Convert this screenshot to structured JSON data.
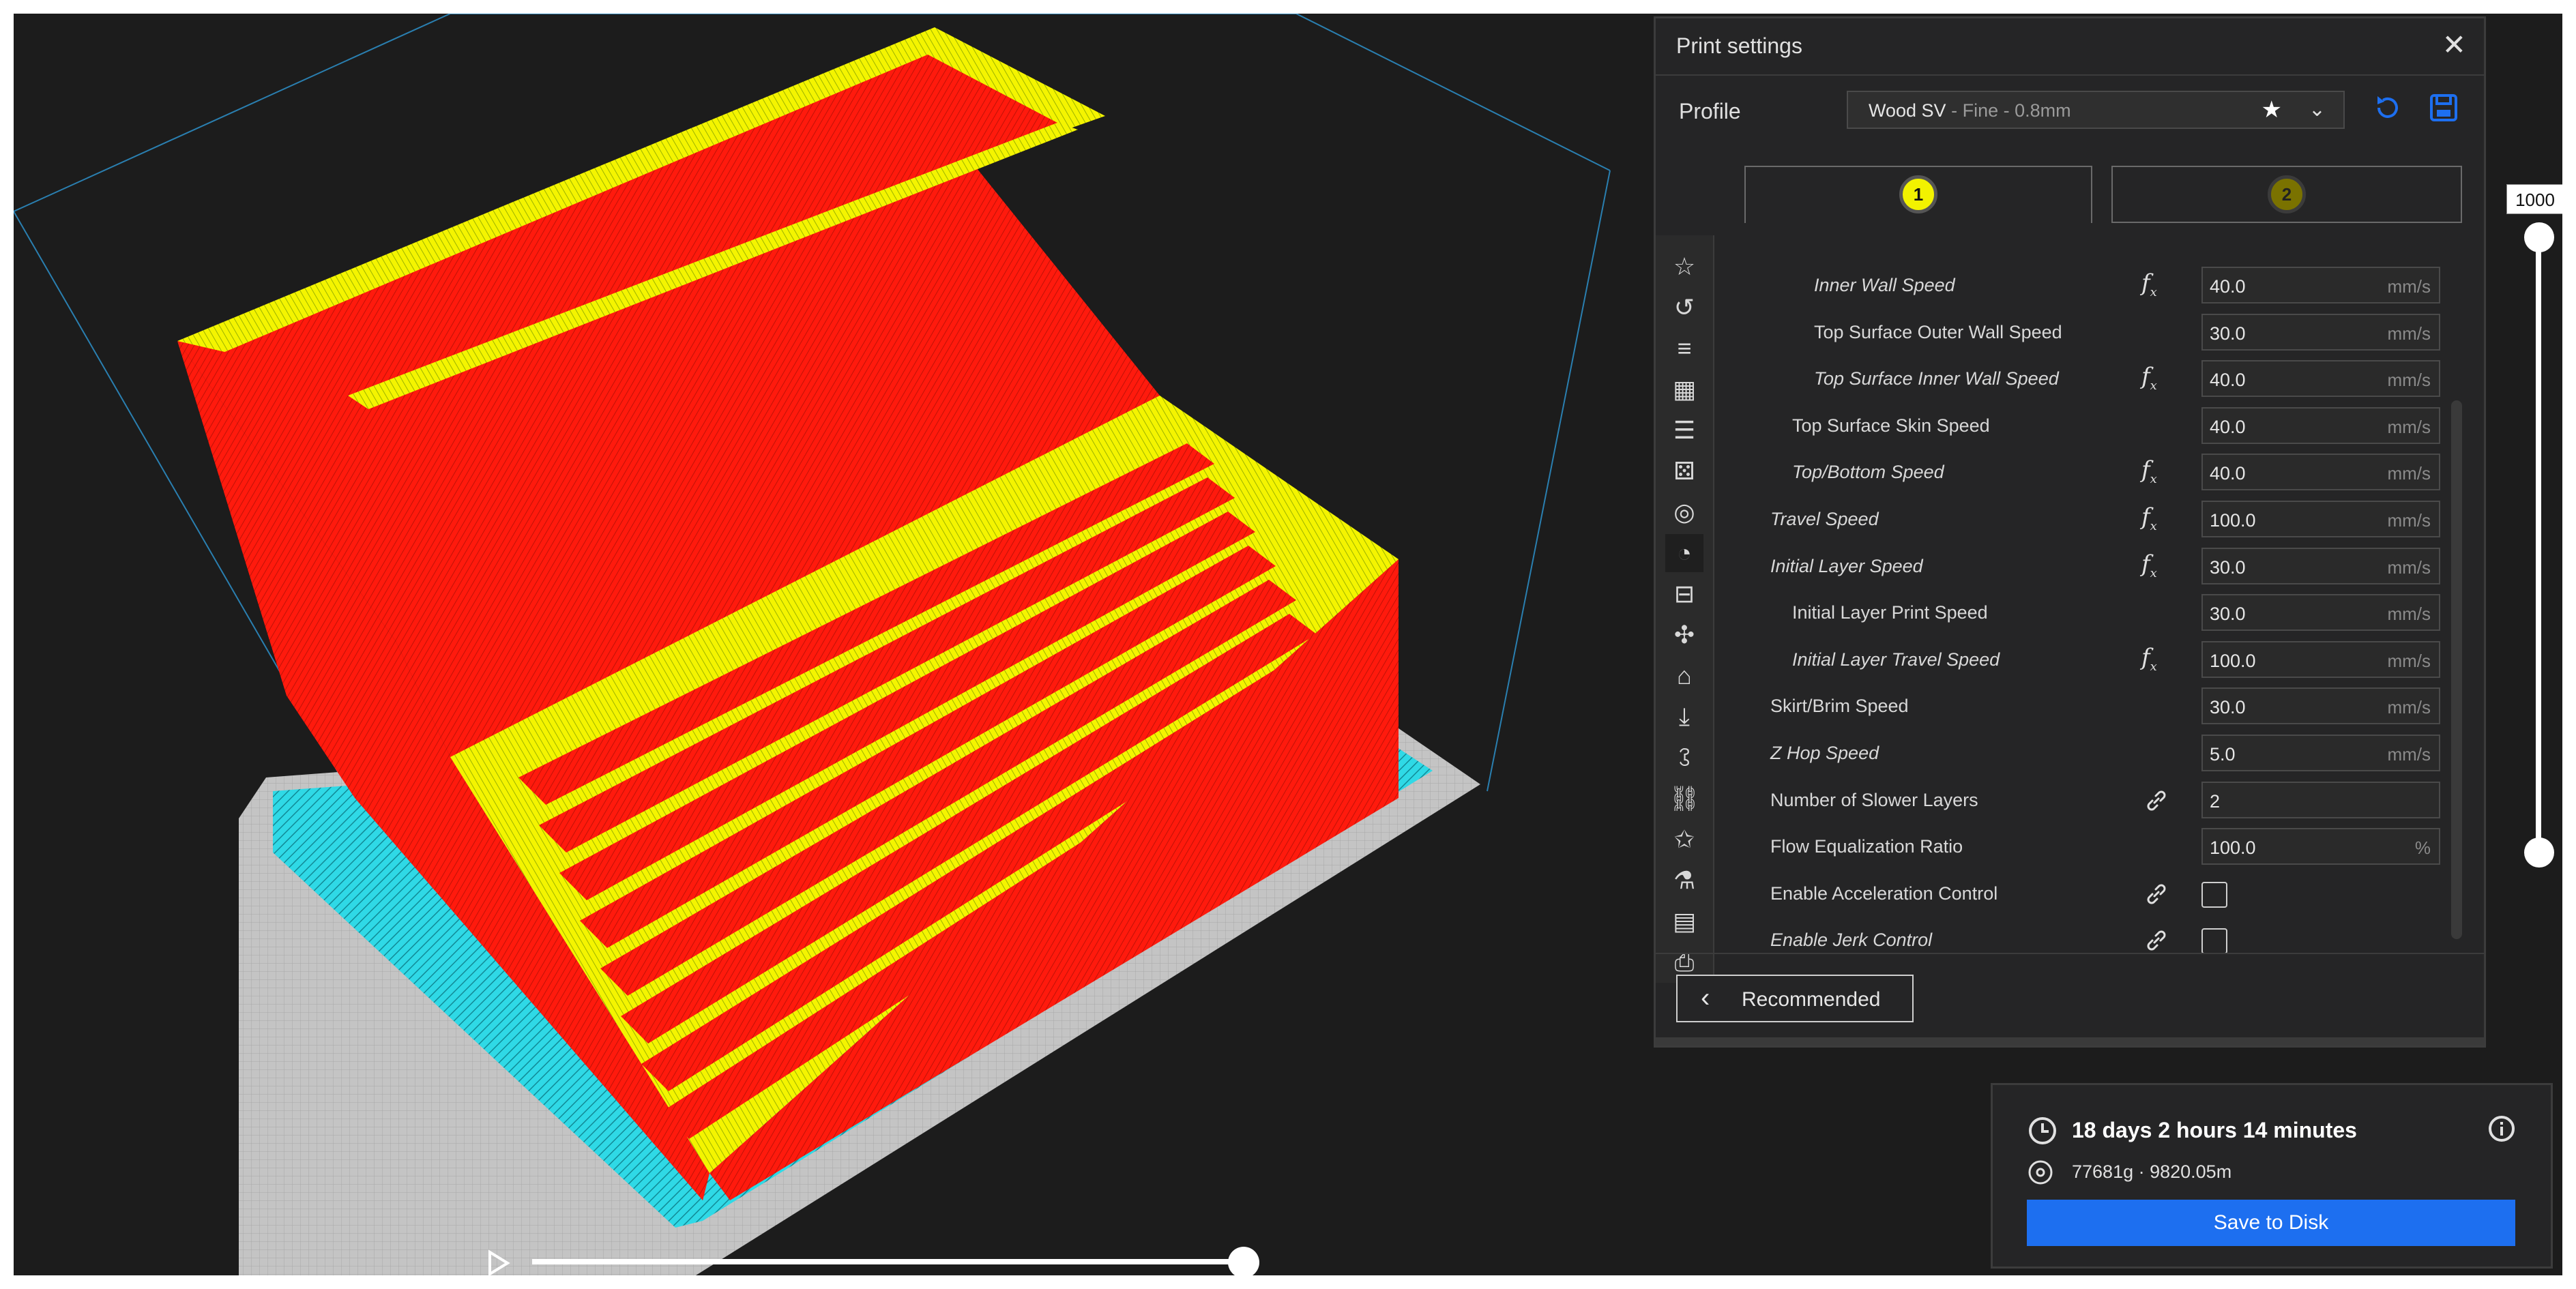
{
  "panel": {
    "title": "Print settings",
    "close_icon": "close-icon",
    "profile_label": "Profile",
    "profile_value": "Wood SV",
    "profile_detail": " - Fine - 0.8mm",
    "tabs": [
      {
        "label": "1"
      },
      {
        "label": "2"
      }
    ],
    "settings": [
      {
        "label": "Inner Wall Speed",
        "italic": true,
        "indent": 2,
        "fx": true,
        "value": "40.0",
        "unit": "mm/s"
      },
      {
        "label": "Top Surface Outer Wall Speed",
        "italic": false,
        "indent": 2,
        "fx": false,
        "value": "30.0",
        "unit": "mm/s"
      },
      {
        "label": "Top Surface Inner Wall Speed",
        "italic": true,
        "indent": 2,
        "fx": true,
        "value": "40.0",
        "unit": "mm/s"
      },
      {
        "label": "Top Surface Skin Speed",
        "italic": false,
        "indent": 1,
        "fx": false,
        "value": "40.0",
        "unit": "mm/s"
      },
      {
        "label": "Top/Bottom Speed",
        "italic": true,
        "indent": 1,
        "fx": true,
        "value": "40.0",
        "unit": "mm/s"
      },
      {
        "label": "Travel Speed",
        "italic": true,
        "indent": 0,
        "fx": true,
        "value": "100.0",
        "unit": "mm/s"
      },
      {
        "label": "Initial Layer Speed",
        "italic": true,
        "indent": 0,
        "fx": true,
        "value": "30.0",
        "unit": "mm/s"
      },
      {
        "label": "Initial Layer Print Speed",
        "italic": false,
        "indent": 1,
        "fx": false,
        "value": "30.0",
        "unit": "mm/s"
      },
      {
        "label": "Initial Layer Travel Speed",
        "italic": true,
        "indent": 1,
        "fx": true,
        "value": "100.0",
        "unit": "mm/s"
      },
      {
        "label": "Skirt/Brim Speed",
        "italic": false,
        "indent": 0,
        "fx": false,
        "value": "30.0",
        "unit": "mm/s"
      },
      {
        "label": "Z Hop Speed",
        "italic": true,
        "indent": 0,
        "fx": false,
        "value": "5.0",
        "unit": "mm/s"
      },
      {
        "label": "Number of Slower Layers",
        "italic": false,
        "indent": 0,
        "link": true,
        "value": "2",
        "unit": ""
      },
      {
        "label": "Flow Equalization Ratio",
        "italic": false,
        "indent": 0,
        "fx": false,
        "value": "100.0",
        "unit": "%"
      },
      {
        "label": "Enable Acceleration Control",
        "italic": false,
        "indent": 0,
        "link": true,
        "checkbox": true
      },
      {
        "label": "Enable Jerk Control",
        "italic": true,
        "indent": 0,
        "link": true,
        "checkbox": true
      }
    ],
    "sidebar_icons": [
      "star-icon",
      "reset-icon",
      "align-icon",
      "grid-icon",
      "layers-icon",
      "dice-icon",
      "speed-circle-icon",
      "gauge-icon",
      "travel-icon",
      "fan-icon",
      "support-icon",
      "adhesion-icon",
      "dual-extrusion-icon",
      "mesh-fix-icon",
      "special-modes-icon",
      "experimental-icon",
      "document-icon",
      "printer-icon"
    ],
    "recommended_label": "Recommended"
  },
  "layer_slider": {
    "value": "1000"
  },
  "estimate": {
    "time": "18 days 2 hours 14 minutes",
    "material": "77681g · 9820.05m",
    "save_label": "Save to Disk"
  },
  "colors": {
    "accent": "#1d6ff0",
    "wall": "#ff1a0d",
    "top": "#f4f400",
    "brim": "#2fd9e6",
    "plate": "#c4c4c4",
    "background": "#1c1c1c"
  }
}
